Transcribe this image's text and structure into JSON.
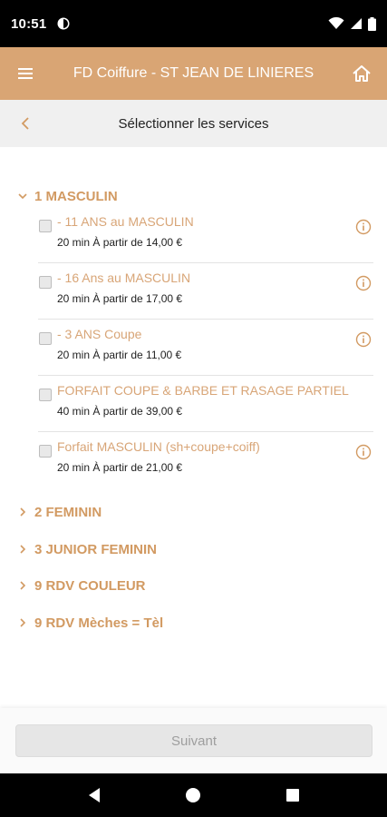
{
  "status_bar": {
    "time": "10:51"
  },
  "app_bar": {
    "title": "FD Coiffure - ST JEAN DE LINIERES",
    "menu_icon": "hamburger-icon",
    "home_icon": "home-icon"
  },
  "sub_header": {
    "title": "Sélectionner les services",
    "back_icon": "chevron-left-icon"
  },
  "categories": [
    {
      "label": "1 MASCULIN",
      "expanded": true,
      "services": [
        {
          "name": "- 11 ANS au MASCULIN",
          "details": "20 min À partir de 14,00 €",
          "has_info": true
        },
        {
          "name": "- 16 Ans au MASCULIN",
          "details": "20 min À partir de 17,00 €",
          "has_info": true
        },
        {
          "name": "- 3 ANS Coupe",
          "details": "20 min À partir de 11,00 €",
          "has_info": true
        },
        {
          "name": "FORFAIT COUPE & BARBE ET RASAGE PARTIEL",
          "details": "40 min À partir de 39,00 €",
          "has_info": false
        },
        {
          "name": "Forfait MASCULIN (sh+coupe+coiff)",
          "details": "20 min À partir de 21,00 €",
          "has_info": true
        }
      ]
    },
    {
      "label": "2 FEMININ",
      "expanded": false
    },
    {
      "label": "3 JUNIOR FEMININ",
      "expanded": false
    },
    {
      "label": "9 RDV COULEUR",
      "expanded": false
    },
    {
      "label": "9 RDV Mèches = Tèl",
      "expanded": false
    }
  ],
  "footer": {
    "next_label": "Suivant"
  },
  "colors": {
    "accent": "#d9a574",
    "category_text": "#d29a62",
    "service_text": "#d8a577"
  }
}
